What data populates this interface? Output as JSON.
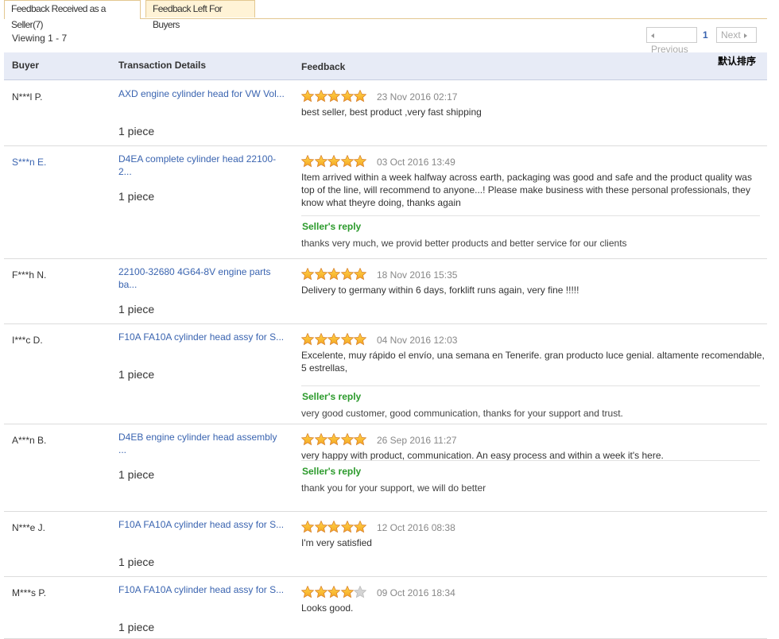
{
  "tabs": [
    {
      "label": "Feedback Received as a Seller(7)",
      "active": true
    },
    {
      "label": "Feedback Left For Buyers",
      "active": false
    }
  ],
  "viewing": "Viewing 1 - 7",
  "pager": {
    "prev": "Previous",
    "current": "1",
    "next": "Next"
  },
  "table": {
    "headers": {
      "buyer": "Buyer",
      "transaction": "Transaction Details",
      "feedback": "Feedback"
    },
    "sort_label": "默认排序"
  },
  "colors": {
    "link": "#3a64b0",
    "reply": "#2b9a2b",
    "star": "#f5a623",
    "header_bg": "#e7ebf6"
  },
  "rows": [
    {
      "buyer": "N***l P.",
      "transaction_line1": "AXD engine cylinder head for VW Vol...",
      "transaction_line2": "",
      "quantity": "1 piece",
      "rating": 5,
      "date": "23 Nov 2016 02:17",
      "feedback": "best seller, best product ,very fast shipping",
      "reply_label": "",
      "reply": ""
    },
    {
      "buyer": "S***n E.",
      "transaction_line1": "D4EA complete cylinder head 22100-",
      "transaction_line2": "2...",
      "quantity": "1 piece",
      "rating": 5,
      "date": "03 Oct 2016 13:49",
      "feedback": "Item arrived within a week halfway across earth, packaging was good and safe and the product quality was top of the line, will recommend to anyone...! Please make business with these personal professionals, they know what theyre doing, thanks again",
      "reply_label": "Seller's reply",
      "reply": "thanks very much, we provid better products and better service for our clients"
    },
    {
      "buyer": "F***h N.",
      "transaction_line1": "22100-32680 4G64-8V engine parts",
      "transaction_line2": "ba...",
      "quantity": "1 piece",
      "rating": 5,
      "date": "18 Nov 2016 15:35",
      "feedback": "Delivery to germany within 6 days, forklift runs again, very fine !!!!!",
      "reply_label": "",
      "reply": ""
    },
    {
      "buyer": "I***c D.",
      "transaction_line1": "F10A FA10A cylinder head assy for S...",
      "transaction_line2": "",
      "quantity": "1 piece",
      "rating": 5,
      "date": "04 Nov 2016 12:03",
      "feedback": "Excelente, muy rápido el envío, una semana en Tenerife. gran producto luce genial. altamente recomendable, 5 estrellas,",
      "reply_label": "Seller's reply",
      "reply": "very good customer, good communication, thanks for your support and trust."
    },
    {
      "buyer": "A***n B.",
      "transaction_line1": "D4EB engine cylinder head assembly",
      "transaction_line2": "...",
      "quantity": "1 piece",
      "rating": 5,
      "date": "26 Sep 2016 11:27",
      "feedback": "very happy with product, communication. An easy process and within a week it's here.",
      "reply_label": "Seller's reply",
      "reply": "thank you for your support, we will do better"
    },
    {
      "buyer": "N***e J.",
      "transaction_line1": "F10A FA10A cylinder head assy for S...",
      "transaction_line2": "",
      "quantity": "1 piece",
      "rating": 5,
      "date": "12 Oct 2016 08:38",
      "feedback": "I'm very satisfied",
      "reply_label": "",
      "reply": ""
    },
    {
      "buyer": "M***s P.",
      "transaction_line1": "F10A FA10A cylinder head assy for S...",
      "transaction_line2": "",
      "quantity": "1 piece",
      "rating": 4,
      "date": "09 Oct 2016 18:34",
      "feedback": "Looks good.",
      "reply_label": "",
      "reply": ""
    }
  ]
}
